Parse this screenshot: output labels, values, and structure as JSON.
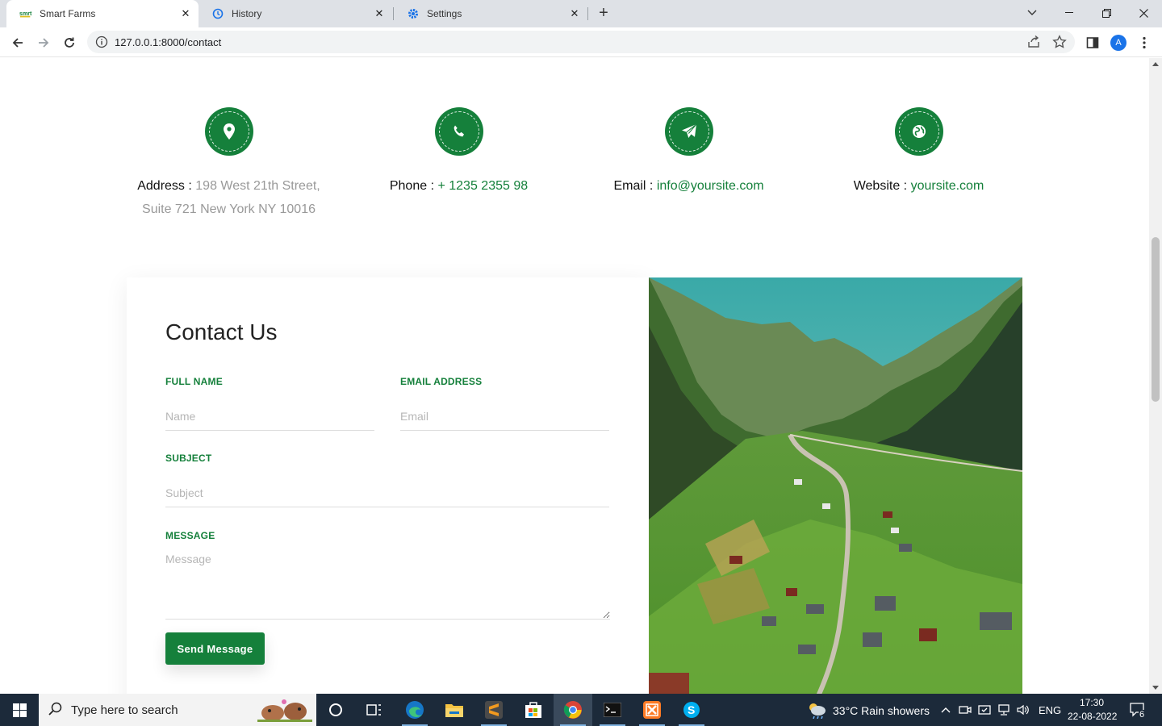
{
  "browser": {
    "tabs": [
      {
        "title": "Smart Farms",
        "icon": "smart-farms-favicon",
        "active": true
      },
      {
        "title": "History",
        "icon": "history-icon",
        "active": false
      },
      {
        "title": "Settings",
        "icon": "gear-icon",
        "active": false
      }
    ],
    "url": "127.0.0.1:8000/contact",
    "profile_initial": "A"
  },
  "contact_info": [
    {
      "icon": "map-pin-icon",
      "label": "Address :",
      "value": "198 West 21th Street, Suite 721 New York NY 10016",
      "is_link": false
    },
    {
      "icon": "phone-icon",
      "label": "Phone :",
      "value": "+ 1235 2355 98",
      "is_link": true
    },
    {
      "icon": "paper-plane-icon",
      "label": "Email :",
      "value": "info@yoursite.com",
      "is_link": true
    },
    {
      "icon": "globe-icon",
      "label": "Website :",
      "value": "yoursite.com",
      "is_link": true
    }
  ],
  "form": {
    "title": "Contact Us",
    "full_name": {
      "label": "FULL NAME",
      "placeholder": "Name",
      "value": ""
    },
    "email": {
      "label": "EMAIL ADDRESS",
      "placeholder": "Email",
      "value": ""
    },
    "subject": {
      "label": "SUBJECT",
      "placeholder": "Subject",
      "value": ""
    },
    "message": {
      "label": "MESSAGE",
      "placeholder": "Message",
      "value": ""
    },
    "submit_label": "Send Message"
  },
  "colors": {
    "accent": "#15803b",
    "muted_text": "#999999"
  },
  "taskbar": {
    "search_placeholder": "Type here to search",
    "weather": "33°C  Rain showers",
    "language": "ENG",
    "time": "17:30",
    "date": "22-08-2022",
    "notification_count": "6"
  }
}
